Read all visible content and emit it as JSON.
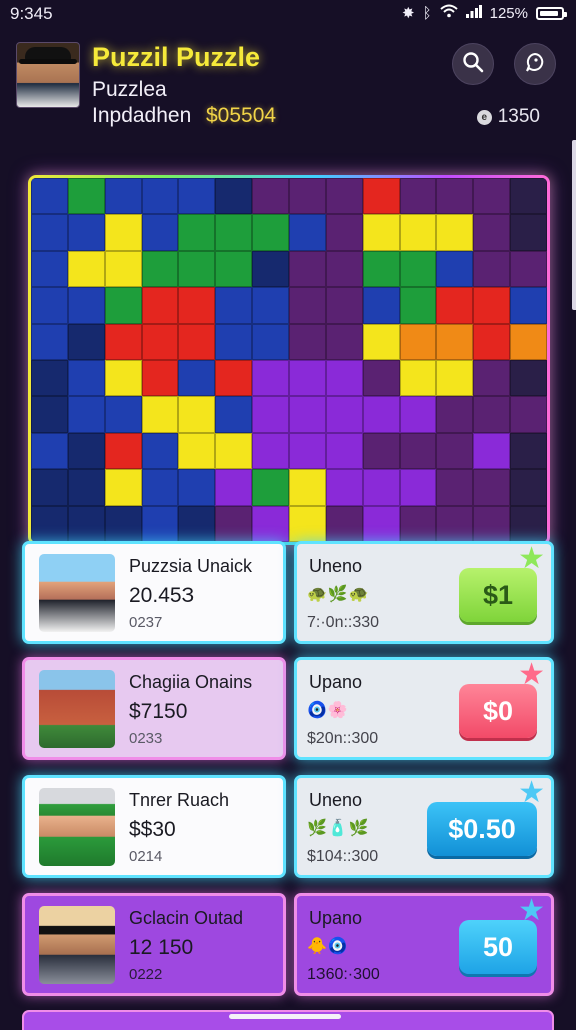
{
  "status_bar": {
    "time": "9:345",
    "battery": "125%"
  },
  "header": {
    "title": "Puzzil Puzzle",
    "subtitle": "Puzzlea",
    "player": "Inpdadhen",
    "money": "$05504",
    "coins": "1350"
  },
  "colors": {
    "accent_yellow": "#f6ea3a",
    "glow_cyan": "#5fe3ff",
    "glow_purple": "#c04dff"
  },
  "offers": [
    {
      "left": {
        "name": "Puzzsia Unaick",
        "price": "20.45З",
        "code": "0237"
      },
      "right": {
        "name": "Uneno",
        "icons": "🐢🌿🐢",
        "time": "7:·0n::330",
        "button": "$1"
      }
    },
    {
      "left": {
        "name": "Chagiia Onains",
        "price": "$7150",
        "code": "0233"
      },
      "right": {
        "name": "Upano",
        "icons": "🧿🌸",
        "time": "$20n::300",
        "button": "$0"
      }
    },
    {
      "left": {
        "name": "Tnrer Ruach",
        "price": "$$30",
        "code": "0214"
      },
      "right": {
        "name": "Uneno",
        "icons": "🌿🧴🌿",
        "time": "$104::300",
        "button": "$0.50"
      }
    },
    {
      "left": {
        "name": "Gclacin Outad",
        "price": "12 150",
        "code": "0222"
      },
      "right": {
        "name": "Upano",
        "icons": "🐥🧿",
        "time": "1З60:·300",
        "button": "50"
      }
    }
  ]
}
